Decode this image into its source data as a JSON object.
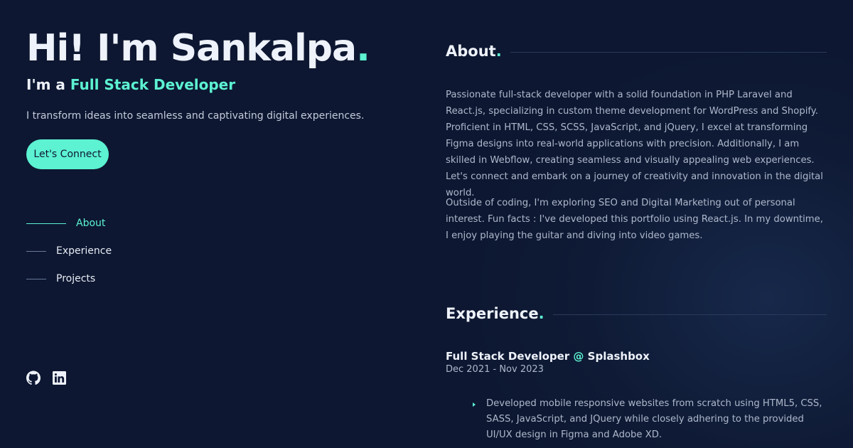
{
  "hero": {
    "title": "Hi! I'm Sankalpa",
    "title_dot": ".",
    "subtitle_prefix": "I'm a ",
    "subtitle_role": "Full Stack Developer",
    "tagline": "I transform ideas into seamless and captivating digital experiences.",
    "cta_label": "Let's Connect"
  },
  "nav": {
    "items": [
      {
        "label": "About",
        "active": true
      },
      {
        "label": "Experience",
        "active": false
      },
      {
        "label": "Projects",
        "active": false
      }
    ]
  },
  "socials": [
    {
      "icon": "github-icon"
    },
    {
      "icon": "linkedin-icon"
    }
  ],
  "about": {
    "title": "About",
    "title_dot": ".",
    "paragraph1": "Passionate full-stack developer with a solid foundation in PHP Laravel and React.js, specializing in custom theme development for WordPress and Shopify. Proficient in HTML, CSS, SCSS, JavaScript, and jQuery, I excel at transforming Figma designs into real-world applications with precision. Additionally, I am skilled in Webflow, creating seamless and visually appealing web experiences. Let's connect and embark on a journey of creativity and innovation in the digital world.",
    "paragraph2": "Outside of coding, I'm exploring SEO and Digital Marketing out of personal interest. Fun facts : I've developed this portfolio using React.js. In my downtime, I enjoy playing the guitar and diving into video games."
  },
  "experience": {
    "title": "Experience",
    "title_dot": ".",
    "jobs": [
      {
        "role": "Full Stack Developer",
        "at": " @ ",
        "company": "Splashbox",
        "dates": "Dec 2021 - Nov 2023",
        "bullets": [
          "Developed mobile responsive websites from scratch using HTML5, CSS, SASS, JavaScript, and JQuery while closely adhering to the provided UI/UX design in Figma and Adobe XD."
        ]
      }
    ]
  },
  "colors": {
    "background": "#0e1833",
    "accent": "#5cf2d2",
    "text": "#eef2fa",
    "muted": "#aeb8cb"
  }
}
